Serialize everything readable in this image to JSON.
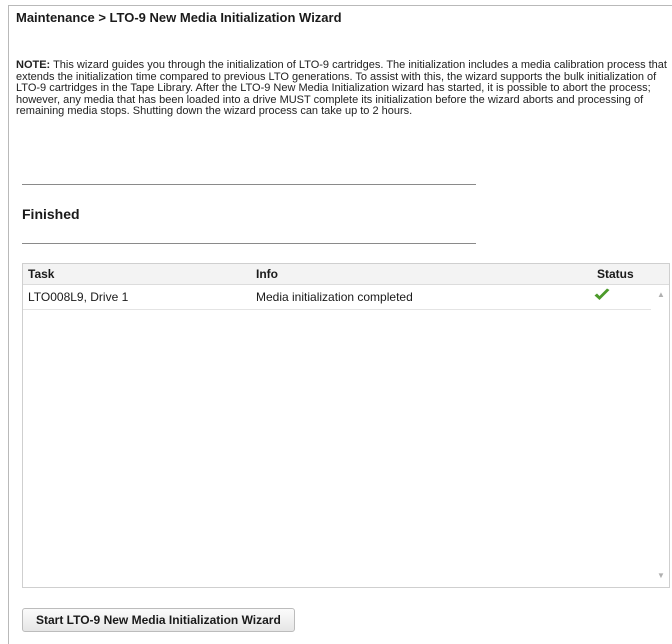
{
  "breadcrumb": {
    "title": "Maintenance > LTO-9 New Media Initialization Wizard"
  },
  "note": {
    "label": "NOTE:",
    "text": " This wizard guides you through the initialization of LTO-9 cartridges. The initialization includes a media calibration process that extends the initialization time compared to previous LTO generations. To assist with this, the wizard supports the bulk initialization of LTO-9 cartridges in the Tape Library. After the LTO-9 New Media Initialization wizard has started, it is possible to abort the process; however, any media that has been loaded into a drive MUST complete its initialization before the wizard aborts and processing of remaining media stops. Shutting down the wizard process can take up to 2 hours."
  },
  "section": {
    "heading": "Finished"
  },
  "table": {
    "columns": [
      "Task",
      "Info",
      "Status"
    ],
    "rows": [
      {
        "task": "LTO008L9, Drive 1",
        "info": "Media initialization completed",
        "status_icon": "green-checkmark-icon"
      }
    ]
  },
  "actions": {
    "start_label": "Start LTO-9 New Media Initialization Wizard"
  },
  "colors": {
    "success": "#4c9a2a"
  }
}
